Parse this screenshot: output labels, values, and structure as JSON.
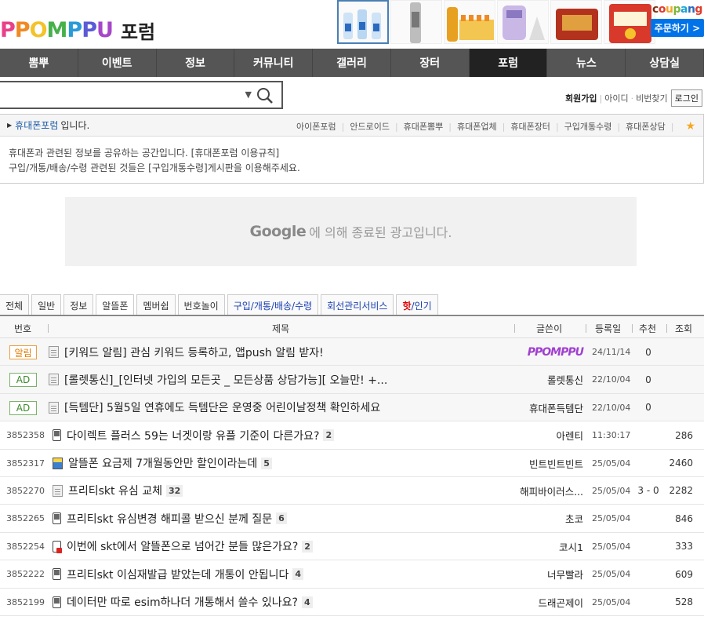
{
  "header": {
    "logo_text": "PPOMPPU",
    "forum_label": "포럼",
    "coupang_logo": "coupang",
    "coupang_button": "주문하기 >"
  },
  "nav": [
    "뽐뿌",
    "이벤트",
    "정보",
    "커뮤니티",
    "갤러리",
    "장터",
    "포럼",
    "뉴스",
    "상담실"
  ],
  "nav_active": "포럼",
  "member": {
    "join": "회원가입",
    "id": "아이디",
    "pw": "비번찾기",
    "login": "로그인"
  },
  "board": {
    "name": "휴대폰포럼",
    "suffix": "입니다.",
    "quick_links": [
      "아이폰포럼",
      "안드로이드",
      "휴대폰뽐뿌",
      "휴대폰업체",
      "휴대폰장터",
      "구입개통수령",
      "휴대폰상담"
    ],
    "desc_line1": "휴대폰과 관련된 정보를 공유하는 공간입니다. [휴대폰포럼 이용규칙]",
    "desc_line2": "구입/개통/배송/수령 관련된 것들은 [구입개통수령]게시판을 이용해주세요."
  },
  "ad": {
    "google": "Google",
    "text": "에 의해 종료된 광고입니다."
  },
  "tabs": [
    "전체",
    "일반",
    "정보",
    "알뜰폰",
    "멤버쉽",
    "번호놀이",
    "구입/개통/배송/수령",
    "회선관리서비스"
  ],
  "tab_hot": {
    "red": "핫",
    "blue": "/인기"
  },
  "table_headers": {
    "no": "번호",
    "title": "제목",
    "author": "글쓴이",
    "date": "등록일",
    "rec": "추천",
    "view": "조회"
  },
  "notices": [
    {
      "badge": "알림",
      "badge_type": "alarm",
      "title": "[키워드 알림] 관심 키워드 등록하고, 앱push 알림 받자!",
      "author": "PPOMPPU",
      "date": "24/11/14",
      "rec": "0",
      "view": ""
    },
    {
      "badge": "AD",
      "badge_type": "ad",
      "title": "[롤렛통신]_[인터넷 가입의 모든곳 _ 모든상품 상담가능][ 오늘만! +...",
      "author": "롤렛통신",
      "date": "22/10/04",
      "rec": "0",
      "view": ""
    },
    {
      "badge": "AD",
      "badge_type": "ad",
      "title": "[득템단] 5월5일 연휴에도 득템단은 운영중 어린이날정책 확인하세요",
      "author": "휴대폰득템단",
      "date": "22/10/04",
      "rec": "0",
      "view": ""
    }
  ],
  "posts": [
    {
      "no": "3852358",
      "icon": "phone",
      "title": "다이렉트 플러스 59는 너겟이랑 유플 기준이 다른가요?",
      "comments": "2",
      "author": "아렌티",
      "date": "11:30:17",
      "rec": "",
      "view": "286"
    },
    {
      "no": "3852317",
      "icon": "img",
      "title": "알뜰폰 요금제 7개월동안만 할인이라는데",
      "comments": "5",
      "author": "빈트빈트빈트",
      "date": "25/05/04",
      "rec": "",
      "view": "2460"
    },
    {
      "no": "3852270",
      "icon": "doc",
      "title": "프리티skt 유심 교체",
      "comments": "32",
      "author": "해피바이러스...",
      "date": "25/05/04",
      "rec": "3 - 0",
      "view": "2282"
    },
    {
      "no": "3852265",
      "icon": "phone",
      "title": "프리티skt 유심변경 해피콜 받으신 분께 질문",
      "comments": "6",
      "author": "초코",
      "date": "25/05/04",
      "rec": "",
      "view": "846"
    },
    {
      "no": "3852254",
      "icon": "lock",
      "title": "이번에 skt에서 알뜰폰으로 넘어간 분들 많은가요?",
      "comments": "2",
      "author": "코시1",
      "date": "25/05/04",
      "rec": "",
      "view": "333"
    },
    {
      "no": "3852222",
      "icon": "phone",
      "title": "프리티skt 이심재발급 받았는데 개통이 안됩니다",
      "comments": "4",
      "author": "너무빨라",
      "date": "25/05/04",
      "rec": "",
      "view": "609"
    },
    {
      "no": "3852199",
      "icon": "phone",
      "title": "데이터만 따로 esim하나더 개통해서 쓸수 있나요?",
      "comments": "4",
      "author": "드래곤제이",
      "date": "25/05/04",
      "rec": "",
      "view": "528"
    }
  ],
  "colors": {
    "nav_bg": "#555555",
    "nav_active": "#222222",
    "link_blue": "#1a5aa8",
    "coupang_blue": "#0073e9"
  },
  "icons": [
    "search-icon",
    "star-icon",
    "dropdown-arrow-icon",
    "doc-icon",
    "phone-icon",
    "image-icon",
    "lock-icon"
  ]
}
